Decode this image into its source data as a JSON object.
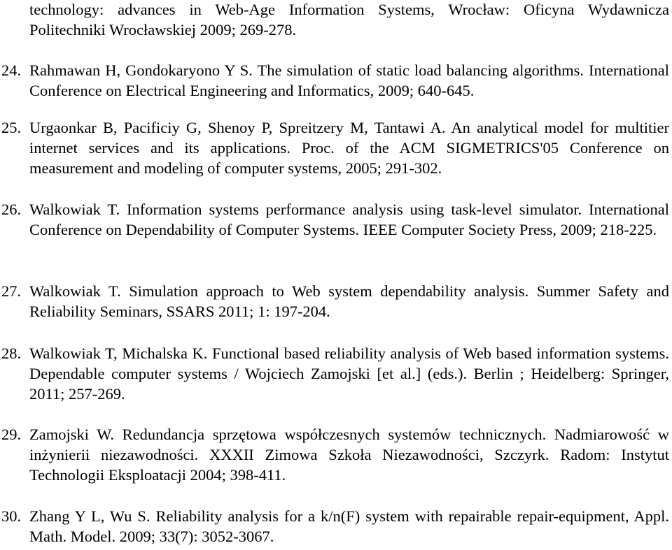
{
  "document": {
    "type": "reference-list",
    "references": [
      {
        "number": "",
        "text": "technology: advances in Web-Age Information Systems, Wrocław: Oficyna Wydawnicza Politechniki Wrocławskiej 2009; 269-278."
      },
      {
        "number": "24.",
        "text": "Rahmawan H, Gondokaryono Y S. The simulation of static load balancing algorithms. International Conference on Electrical Engineering and Informatics, 2009; 640-645."
      },
      {
        "number": "25.",
        "text": "Urgaonkar B, Pacificiy G, Shenoy P, Spreitzery M, Tantawi A. An analytical model for multitier internet services and its applications. Proc. of the ACM SIGMETRICS'05 Conference on measurement and modeling of computer systems, 2005; 291-302."
      },
      {
        "number": "26.",
        "text": "Walkowiak T. Information systems performance analysis using task-level simulator. International Conference on Dependability of Computer Systems. IEEE Computer Society Press, 2009; 218-225."
      },
      {
        "number": "27.",
        "text": "Walkowiak T. Simulation approach to Web system dependability analysis. Summer Safety and Reliability Seminars, SSARS 2011; 1: 197-204."
      },
      {
        "number": "28.",
        "text": "Walkowiak T, Michalska K. Functional based reliability analysis of Web based information systems. Dependable computer systems / Wojciech Zamojski [et al.] (eds.). Berlin ; Heidelberg: Springer, 2011;  257-269."
      },
      {
        "number": "29.",
        "text": "Zamojski W. Redundancja sprzętowa współczesnych systemów technicznych. Nadmiarowość w inżynierii niezawodności. XXXII Zimowa Szkoła Niezawodności, Szczyrk. Radom: Instytut Technologii Eksploatacji 2004; 398-411."
      },
      {
        "number": "30.",
        "text": "Zhang Y L, Wu S. Reliability analysis for a k/n(F) system with repairable repair-equipment, Appl. Math. Model.  2009; 33(7): 3052-3067."
      }
    ]
  }
}
